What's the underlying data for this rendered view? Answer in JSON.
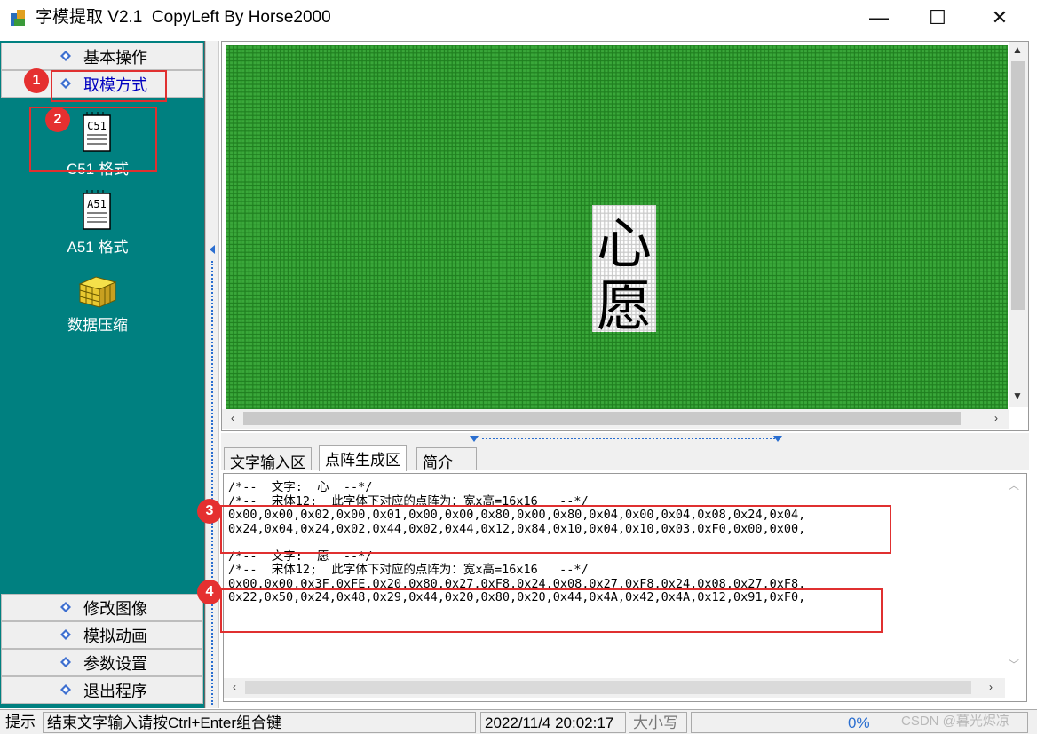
{
  "window": {
    "title": "字模提取 V2.1  CopyLeft By Horse2000",
    "min_symbol": "—",
    "max_symbol": "☐",
    "close_symbol": "✕"
  },
  "left_panel": {
    "top_buttons": [
      {
        "label": "基本操作",
        "icon": "diamond-icon"
      },
      {
        "label": "取模方式",
        "icon": "diamond-icon"
      }
    ],
    "tools": [
      {
        "label": "C51 格式",
        "icon_text": "C51"
      },
      {
        "label": "A51 格式",
        "icon_text": "A51"
      },
      {
        "label": "数据压缩",
        "icon": "cube-icon"
      }
    ],
    "bottom_buttons": [
      {
        "label": "修改图像",
        "icon": "diamond-icon"
      },
      {
        "label": "模拟动画",
        "icon": "diamond-icon"
      },
      {
        "label": "参数设置",
        "icon": "diamond-icon"
      },
      {
        "label": "退出程序",
        "icon": "diamond-icon"
      }
    ],
    "background_color": "#008080"
  },
  "grid": {
    "background_color": "#2e9e2e",
    "glyph_chars": [
      "心",
      "愿"
    ]
  },
  "tabs": [
    {
      "label": "文字输入区",
      "active": false
    },
    {
      "label": "点阵生成区",
      "active": true
    },
    {
      "label": "简介",
      "active": false
    }
  ],
  "output": {
    "lines": [
      "/*--  文字:  心  --*/",
      "/*--  宋体12;  此字体下对应的点阵为：宽x高=16x16   --*/",
      "0x00,0x00,0x02,0x00,0x01,0x00,0x00,0x80,0x00,0x80,0x04,0x00,0x04,0x08,0x24,0x04,",
      "0x24,0x04,0x24,0x02,0x44,0x02,0x44,0x12,0x84,0x10,0x04,0x10,0x03,0xF0,0x00,0x00,",
      "",
      "/*--  文字:  愿  --*/",
      "/*--  宋体12;  此字体下对应的点阵为：宽x高=16x16   --*/",
      "0x00,0x00,0x3F,0xFE,0x20,0x80,0x27,0xF8,0x24,0x08,0x27,0xF8,0x24,0x08,0x27,0xF8,",
      "0x22,0x50,0x24,0x48,0x29,0x44,0x20,0x80,0x20,0x44,0x4A,0x42,0x4A,0x12,0x91,0xF0,"
    ]
  },
  "annotations": {
    "badges": [
      "1",
      "2",
      "3",
      "4"
    ],
    "color": "#e03030"
  },
  "statusbar": {
    "hint_label": "提示",
    "hint_text": "结束文字输入请按Ctrl+Enter组合键",
    "datetime": "2022/11/4 20:02:17",
    "caps": "大小写",
    "progress": "0%"
  },
  "watermark": "CSDN @暮光烬凉"
}
